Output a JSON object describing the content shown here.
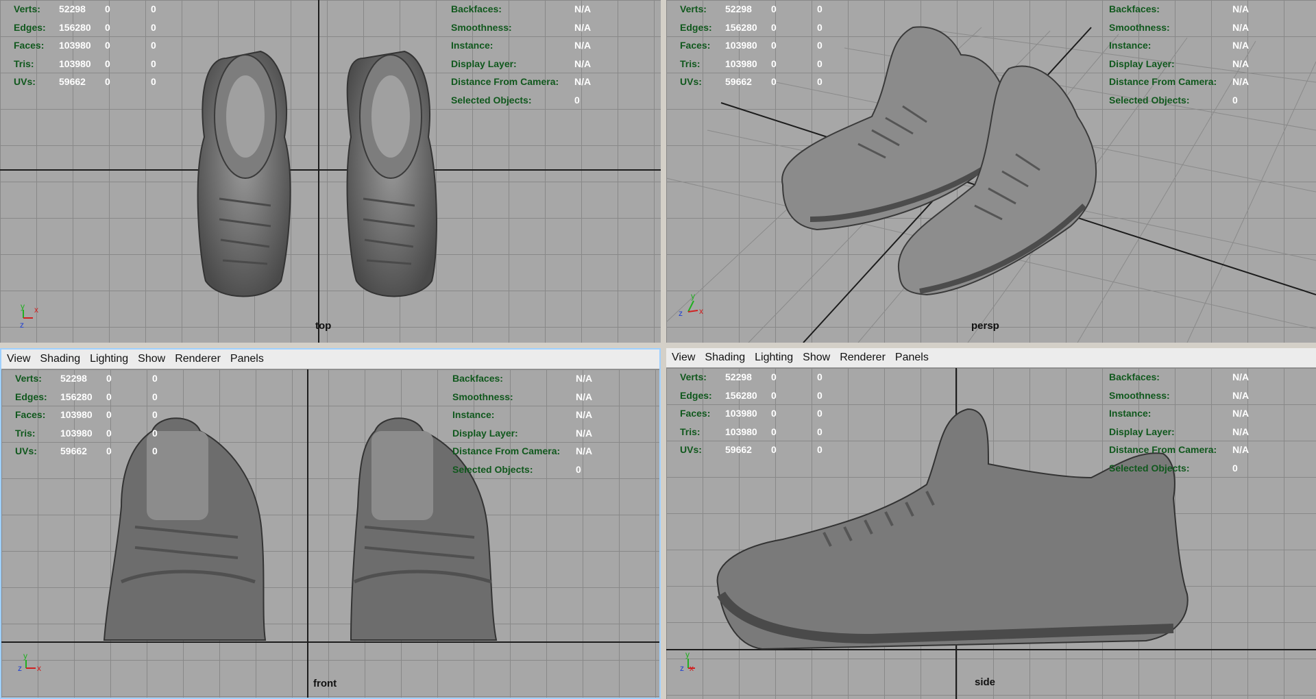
{
  "menu": [
    "View",
    "Shading",
    "Lighting",
    "Show",
    "Renderer",
    "Panels"
  ],
  "hud_stats": [
    {
      "label": "Verts:",
      "v1": "52298",
      "v2": "0",
      "v3": "0"
    },
    {
      "label": "Edges:",
      "v1": "156280",
      "v2": "0",
      "v3": "0"
    },
    {
      "label": "Faces:",
      "v1": "103980",
      "v2": "0",
      "v3": "0"
    },
    {
      "label": "Tris:",
      "v1": "103980",
      "v2": "0",
      "v3": "0"
    },
    {
      "label": "UVs:",
      "v1": "59662",
      "v2": "0",
      "v3": "0"
    }
  ],
  "hud_info": [
    {
      "label": "Backfaces:",
      "value": "N/A"
    },
    {
      "label": "Smoothness:",
      "value": "N/A"
    },
    {
      "label": "Instance:",
      "value": "N/A"
    },
    {
      "label": "Display Layer:",
      "value": "N/A"
    },
    {
      "label": "Distance From Camera:",
      "value": "N/A"
    },
    {
      "label": "Selected Objects:",
      "value": "0"
    }
  ],
  "cameras": {
    "top": "top",
    "persp": "persp",
    "front": "front",
    "side": "side"
  },
  "axes": {
    "x": "x",
    "y": "y",
    "z": "z"
  },
  "colors": {
    "viewport_bg": "#a7a7a7",
    "grid": "#888888",
    "hud_text": "#10581d",
    "axis_x": "#d02020",
    "axis_y": "#20b020",
    "axis_z": "#2040d0"
  }
}
